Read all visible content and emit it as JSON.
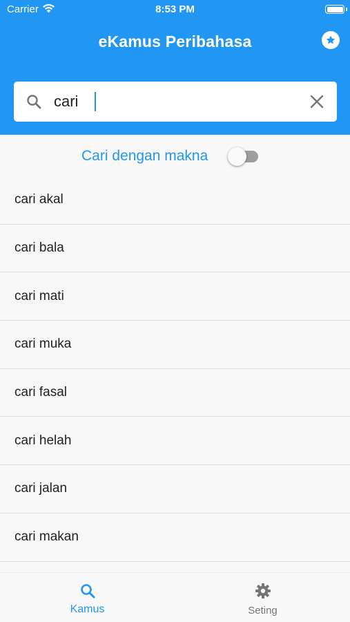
{
  "status_bar": {
    "carrier": "Carrier",
    "time": "8:53 PM"
  },
  "app": {
    "title": "eKamus Peribahasa",
    "accent_color": "#2196f3"
  },
  "search": {
    "value": "cari",
    "placeholder": ""
  },
  "toggle": {
    "label": "Cari dengan makna",
    "on": false
  },
  "results": [
    {
      "label": "cari akal"
    },
    {
      "label": "cari bala"
    },
    {
      "label": "cari mati"
    },
    {
      "label": "cari muka"
    },
    {
      "label": "cari fasal"
    },
    {
      "label": "cari helah"
    },
    {
      "label": "cari jalan"
    },
    {
      "label": "cari makan"
    }
  ],
  "bottom_nav": {
    "kamus_label": "Kamus",
    "seting_label": "Seting",
    "kamus_icon": "search-icon",
    "seting_icon": "gear-icon"
  }
}
